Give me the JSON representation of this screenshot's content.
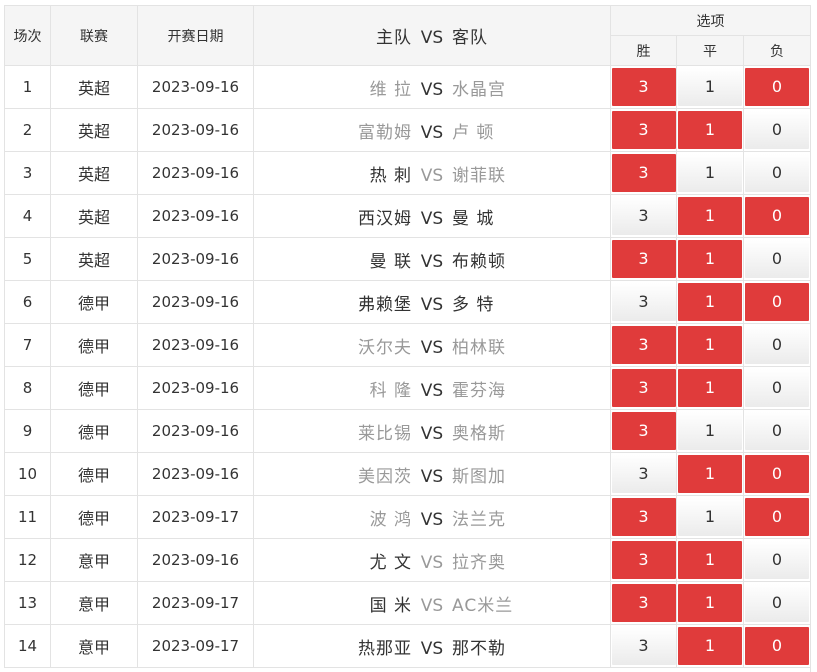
{
  "header": {
    "col_index": "场次",
    "col_league": "联赛",
    "col_date": "开赛日期",
    "col_home": "主队",
    "col_vs": "VS",
    "col_away": "客队",
    "options": "选项",
    "win": "胜",
    "draw": "平",
    "lose": "负"
  },
  "colors": {
    "selected": "#e03b3b",
    "unselected": "#f0f0f0"
  },
  "rows": [
    {
      "idx": "1",
      "league": "英超",
      "date": "2023-09-16",
      "home": "维 拉",
      "vs": "VS",
      "away": "水晶宫",
      "emph": "none",
      "win": "3",
      "draw": "1",
      "lose": "0",
      "sel": [
        true,
        false,
        true
      ]
    },
    {
      "idx": "2",
      "league": "英超",
      "date": "2023-09-16",
      "home": "富勒姆",
      "vs": "VS",
      "away": "卢 顿",
      "emph": "none",
      "win": "3",
      "draw": "1",
      "lose": "0",
      "sel": [
        true,
        true,
        false
      ]
    },
    {
      "idx": "3",
      "league": "英超",
      "date": "2023-09-16",
      "home": "热 刺",
      "vs": "VS",
      "away": "谢菲联",
      "emph": "home",
      "win": "3",
      "draw": "1",
      "lose": "0",
      "sel": [
        true,
        false,
        false
      ]
    },
    {
      "idx": "4",
      "league": "英超",
      "date": "2023-09-16",
      "home": "西汉姆",
      "vs": "VS",
      "away": "曼 城",
      "emph": "both",
      "win": "3",
      "draw": "1",
      "lose": "0",
      "sel": [
        false,
        true,
        true
      ]
    },
    {
      "idx": "5",
      "league": "英超",
      "date": "2023-09-16",
      "home": "曼 联",
      "vs": "VS",
      "away": "布赖顿",
      "emph": "both",
      "win": "3",
      "draw": "1",
      "lose": "0",
      "sel": [
        true,
        true,
        false
      ]
    },
    {
      "idx": "6",
      "league": "德甲",
      "date": "2023-09-16",
      "home": "弗赖堡",
      "vs": "VS",
      "away": "多 特",
      "emph": "both",
      "win": "3",
      "draw": "1",
      "lose": "0",
      "sel": [
        false,
        true,
        true
      ]
    },
    {
      "idx": "7",
      "league": "德甲",
      "date": "2023-09-16",
      "home": "沃尔夫",
      "vs": "VS",
      "away": "柏林联",
      "emph": "none",
      "win": "3",
      "draw": "1",
      "lose": "0",
      "sel": [
        true,
        true,
        false
      ]
    },
    {
      "idx": "8",
      "league": "德甲",
      "date": "2023-09-16",
      "home": "科 隆",
      "vs": "VS",
      "away": "霍芬海",
      "emph": "none",
      "win": "3",
      "draw": "1",
      "lose": "0",
      "sel": [
        true,
        true,
        false
      ]
    },
    {
      "idx": "9",
      "league": "德甲",
      "date": "2023-09-16",
      "home": "莱比锡",
      "vs": "VS",
      "away": "奥格斯",
      "emph": "none",
      "win": "3",
      "draw": "1",
      "lose": "0",
      "sel": [
        true,
        false,
        false
      ]
    },
    {
      "idx": "10",
      "league": "德甲",
      "date": "2023-09-16",
      "home": "美因茨",
      "vs": "VS",
      "away": "斯图加",
      "emph": "none",
      "win": "3",
      "draw": "1",
      "lose": "0",
      "sel": [
        false,
        true,
        true
      ]
    },
    {
      "idx": "11",
      "league": "德甲",
      "date": "2023-09-17",
      "home": "波 鸿",
      "vs": "VS",
      "away": "法兰克",
      "emph": "none",
      "win": "3",
      "draw": "1",
      "lose": "0",
      "sel": [
        true,
        false,
        true
      ]
    },
    {
      "idx": "12",
      "league": "意甲",
      "date": "2023-09-16",
      "home": "尤 文",
      "vs": "VS",
      "away": "拉齐奥",
      "emph": "home",
      "win": "3",
      "draw": "1",
      "lose": "0",
      "sel": [
        true,
        true,
        false
      ]
    },
    {
      "idx": "13",
      "league": "意甲",
      "date": "2023-09-17",
      "home": "国 米",
      "vs": "VS",
      "away": "AC米兰",
      "emph": "home",
      "win": "3",
      "draw": "1",
      "lose": "0",
      "sel": [
        true,
        true,
        false
      ]
    },
    {
      "idx": "14",
      "league": "意甲",
      "date": "2023-09-17",
      "home": "热那亚",
      "vs": "VS",
      "away": "那不勒",
      "emph": "both",
      "win": "3",
      "draw": "1",
      "lose": "0",
      "sel": [
        false,
        true,
        true
      ]
    }
  ]
}
